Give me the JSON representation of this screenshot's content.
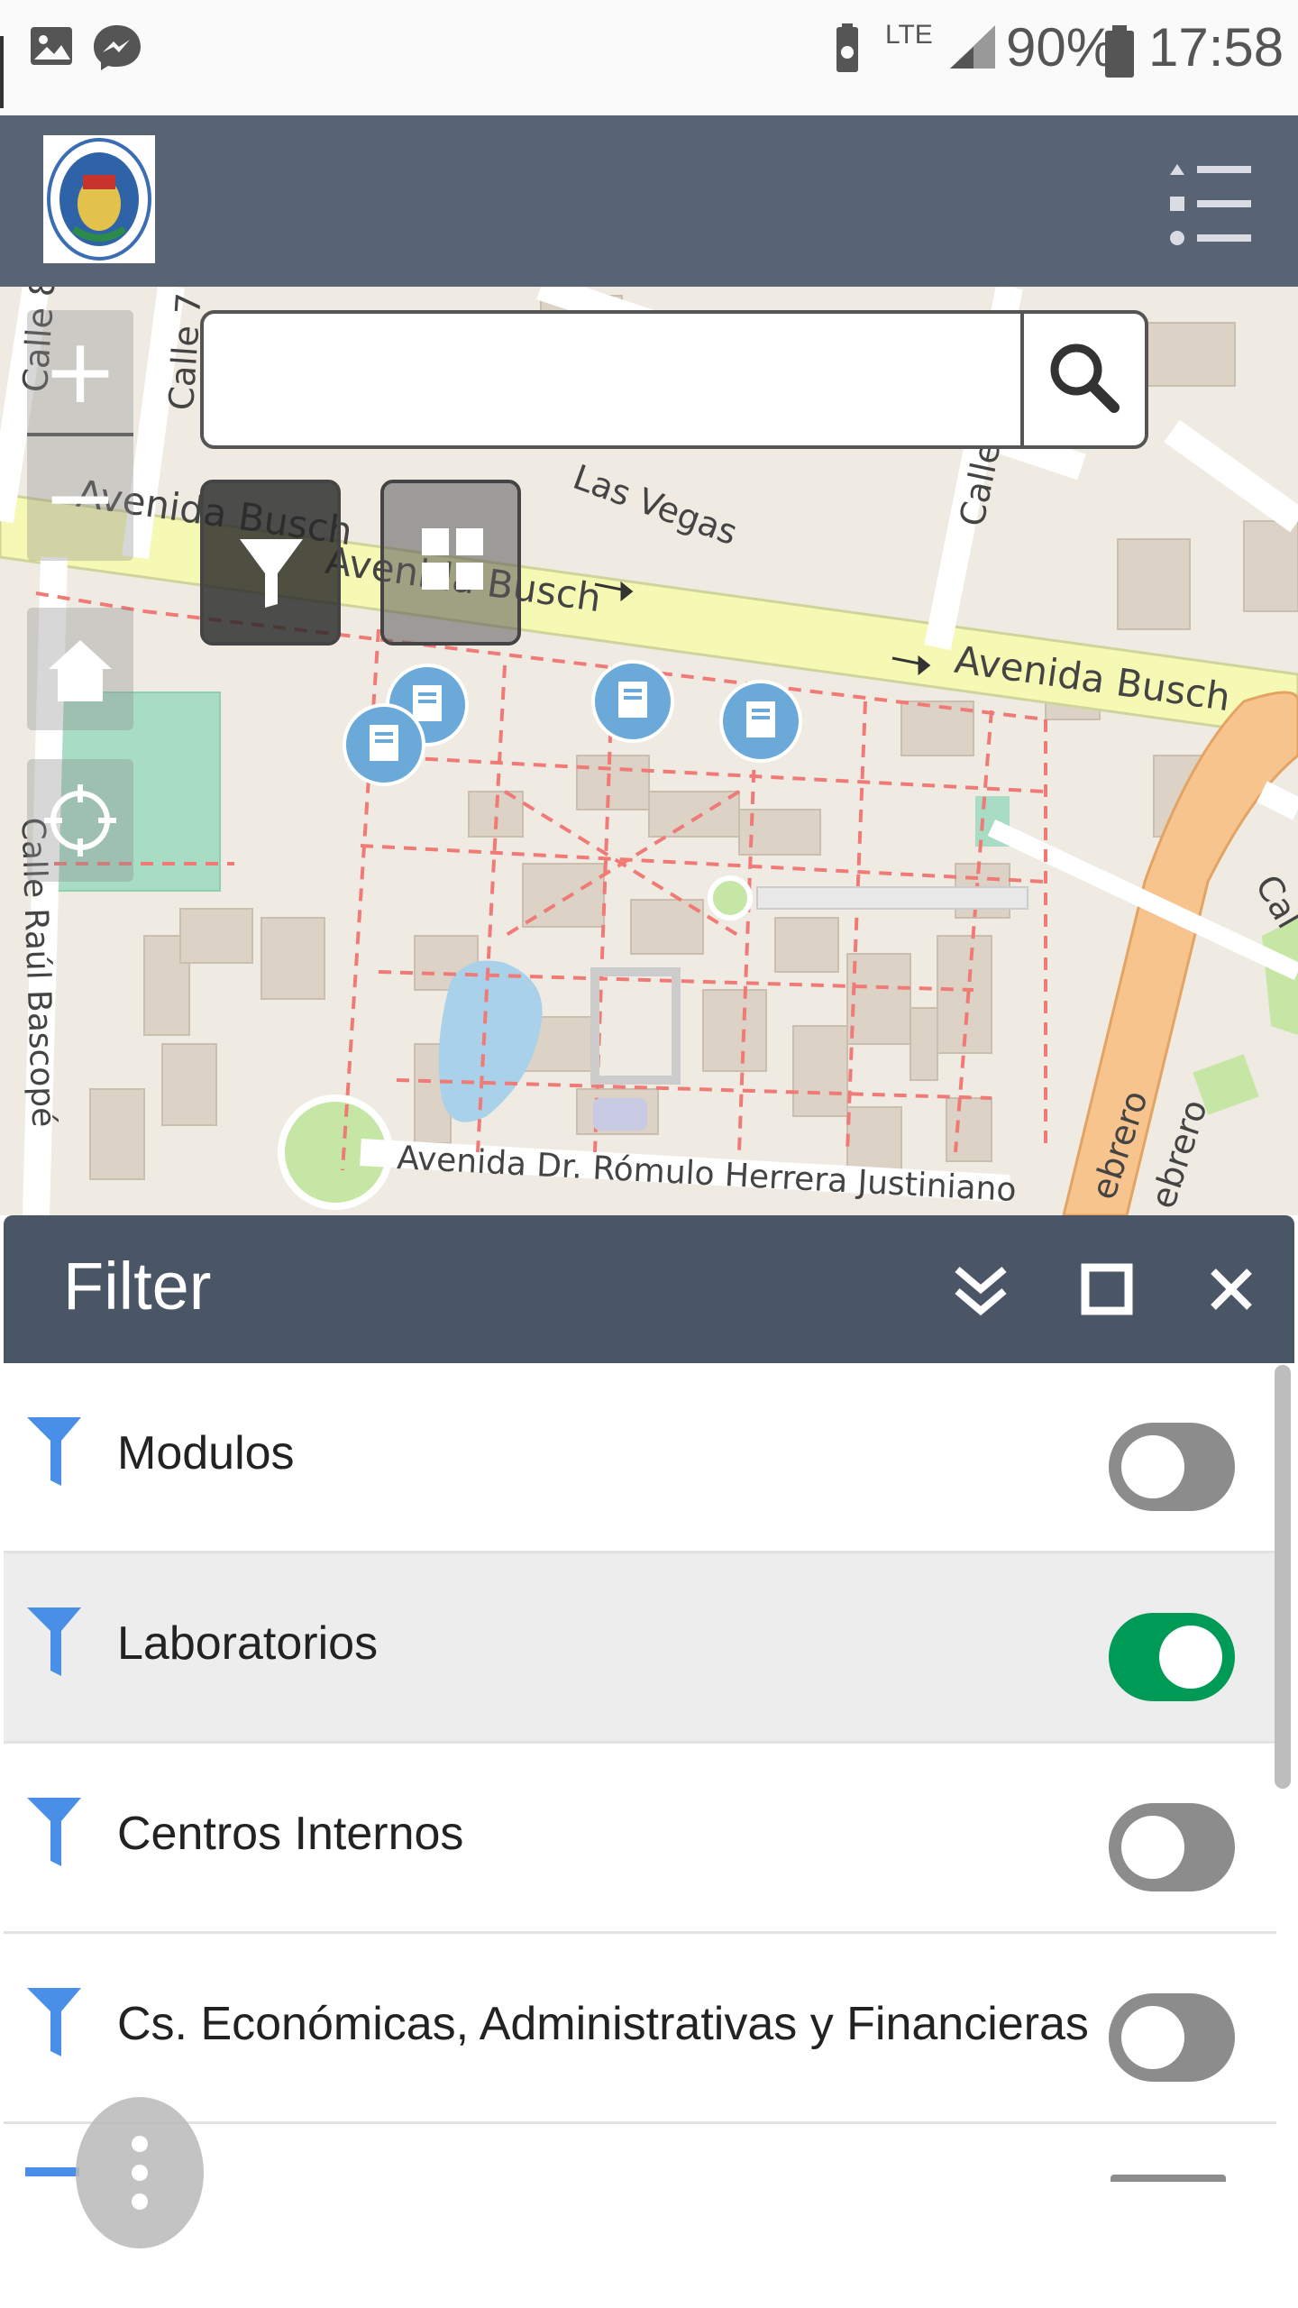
{
  "status_bar": {
    "network": "LTE",
    "battery": "90%",
    "time": "17:58"
  },
  "map": {
    "streets": [
      "Avenida Busch",
      "Avenida Busch",
      "Avenida Busch",
      "Las Vegas",
      "Calle Manu",
      "Calle 7",
      "Calle 8",
      "Calle Raúl Bascopé",
      "Avenida Dr. Rómulo Herrera Justiniano",
      "Cal",
      "ebrero",
      "ebrero"
    ],
    "search": {
      "value": "",
      "placeholder": ""
    },
    "zoom_in_label": "+",
    "zoom_out_label": "−"
  },
  "filter_panel": {
    "title": "Filter",
    "items": [
      {
        "label": "Modulos",
        "enabled": false
      },
      {
        "label": "Laboratorios",
        "enabled": true
      },
      {
        "label": "Centros Internos",
        "enabled": false
      },
      {
        "label": "Cs. Económicas, Administrativas y Financieras",
        "enabled": false
      }
    ]
  },
  "colors": {
    "header": "#586373",
    "panel_header": "#4a5566",
    "toggle_on": "#009a57",
    "toggle_off": "#8c8c8c",
    "funnel": "#4a8fe7",
    "marker": "#6aa9d8"
  }
}
